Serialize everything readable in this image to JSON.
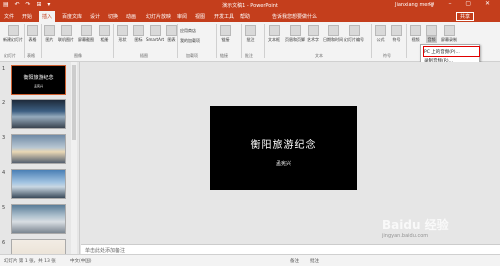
{
  "titlebar": {
    "quick_access": "▤ ↶ ↷ ⊞ ▾",
    "document": "演示文稿1 - PowerPoint",
    "user": "Jianxiang meng",
    "window_controls": "▭ – ▢ ✕"
  },
  "tabs": [
    "文件",
    "开始",
    "插入",
    "百度文库",
    "设计",
    "切换",
    "动画",
    "幻灯片放映",
    "审阅",
    "视图",
    "开发工具",
    "帮助"
  ],
  "active_tab": "插入",
  "tell_me": "告诉我您想要做什么",
  "share": "共享",
  "ribbon": {
    "buttons": {
      "new_slide": "新建幻灯片",
      "table": "表格",
      "image": "图片",
      "online_image": "联机图片",
      "screenshot": "屏幕截图",
      "album": "相册",
      "shapes": "形状",
      "icons": "图标",
      "smartart": "SmartArt",
      "chart": "图表",
      "store": "应用商店",
      "my_addins": "我的加载项",
      "link": "链接",
      "comment": "批注",
      "textbox": "文本框",
      "header_footer": "页眉和页脚",
      "wordart": "艺术字",
      "date_time": "日期和时间",
      "slide_number": "幻灯片编号",
      "equation": "公式",
      "symbol": "符号",
      "video": "视频",
      "audio": "音频",
      "screen_record": "屏幕录制"
    },
    "groups": {
      "slides": "幻灯片",
      "tables": "表格",
      "images": "图像",
      "illustrations": "插图",
      "addins": "加载项",
      "links": "链接",
      "comments": "批注",
      "text": "文本",
      "symbols": "符号",
      "media": "媒体"
    }
  },
  "audio_menu": {
    "item1": "PC 上的音频(P)...",
    "item2": "录制音频(R)..."
  },
  "thumbnails": {
    "numbers": [
      "1",
      "2",
      "3",
      "4",
      "5",
      "6"
    ],
    "slide1_title": "衡阳旅游纪念",
    "slide1_sub": "孟宪兴"
  },
  "slide": {
    "title": "衡阳旅游纪念",
    "subtitle": "孟宪兴"
  },
  "notes_placeholder": "单击此处添加备注",
  "status": {
    "slide_count": "幻灯片 第 1 张，共 13 张",
    "language": "中文(中国)",
    "notes": "备注",
    "comments": "批注"
  },
  "watermark": {
    "text": "Baidu 经验",
    "url": "jingyan.baidu.com"
  },
  "colors": {
    "accent": "#c43e1c",
    "highlight": "#e00000"
  }
}
